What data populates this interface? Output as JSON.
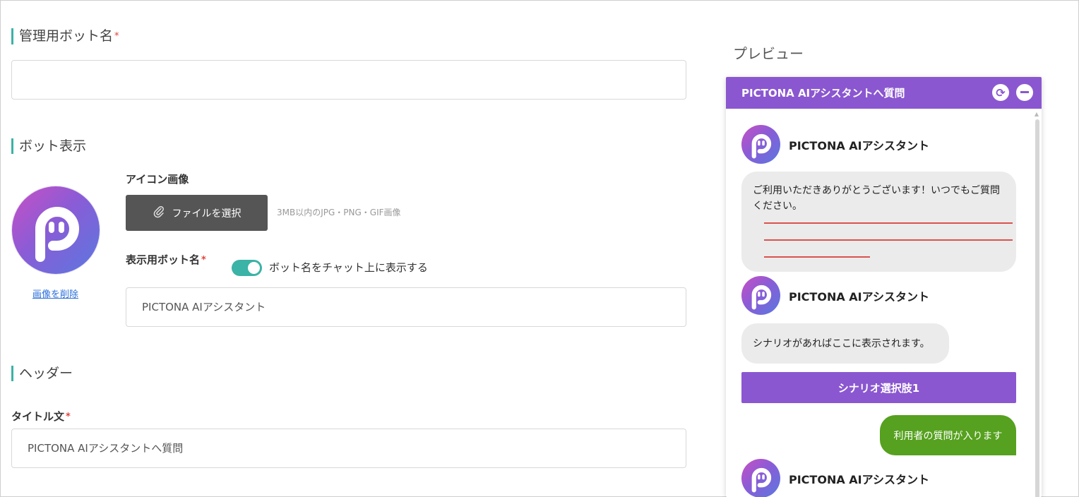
{
  "form": {
    "sections": {
      "admin_bot_name": "管理用ボット名",
      "bot_display": "ボット表示",
      "header": "ヘッダー"
    },
    "required_mark": "*",
    "admin_bot_name_value": "",
    "icon_label": "アイコン画像",
    "file_button": "ファイルを選択",
    "file_hint": "3MB以内のJPG・PNG・GIF画像",
    "delete_image": "画像を削除",
    "display_name_label": "表示用ボット名",
    "toggle_label": "ボット名をチャット上に表示する",
    "toggle_on": true,
    "display_name_value": "PICTONA AIアシスタント",
    "title_label": "タイトル文",
    "title_value": "PICTONA AIアシスタントへ質問"
  },
  "preview": {
    "title": "プレビュー",
    "header_title": "PICTONA AIアシスタントへ質問",
    "bot_name": "PICTONA AIアシスタント",
    "welcome_message": "ご利用いただきありがとうございます！いつでもご質問ください。",
    "scenario_message": "シナリオがあればここに表示されます。",
    "scenario_option": "シナリオ選択肢1",
    "user_message": "利用者の質問が入ります"
  },
  "colors": {
    "accent_teal": "#3bb3a6",
    "chat_purple": "#8a57d0",
    "user_green": "#56a11f",
    "required_red": "#e0433a"
  },
  "icons": [
    "paperclip-icon",
    "refresh-icon",
    "minimize-icon",
    "bot-avatar-icon"
  ]
}
